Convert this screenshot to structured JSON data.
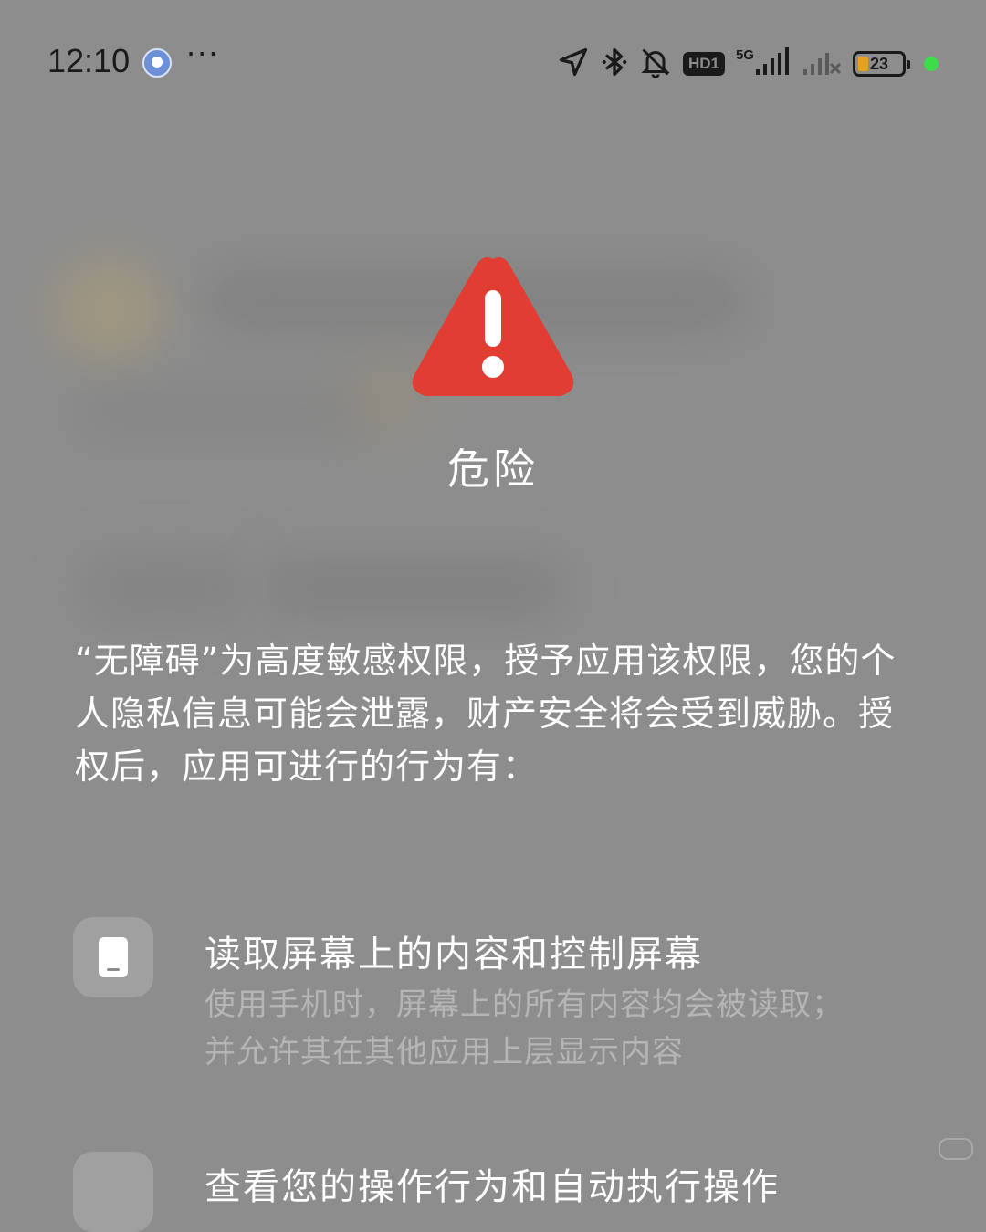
{
  "status_bar": {
    "time": "12:10",
    "more": "···",
    "hd_label": "HD1",
    "network_label": "5G",
    "battery_percent": "23",
    "battery_level": 0.23
  },
  "dialog": {
    "icon": "warning-triangle-icon",
    "icon_color": "#e23d33",
    "title": "危险",
    "description": "“无障碍”为高度敏感权限，授予应用该权限，您的个人隐私信息可能会泄露，财产安全将会受到威胁。授权后，应用可进行的行为有：",
    "permissions": [
      {
        "icon": "phone-icon",
        "title": "读取屏幕上的内容和控制屏幕",
        "description": "使用手机时，屏幕上的所有内容均会被读取；并允许其在其他应用上层显示内容"
      },
      {
        "title": "查看您的操作行为和自动执行操作"
      }
    ]
  }
}
